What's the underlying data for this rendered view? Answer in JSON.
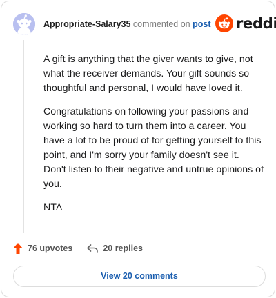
{
  "comment": {
    "username": "Appropriate-Salary35",
    "action_text": "commented on",
    "post_link": "post",
    "paragraphs": [
      "A gift is anything that the giver wants to give, not what the receiver demands. Your gift sounds so thoughtful and personal, I would have loved it.",
      "Congratulations on following your passions and working so hard to turn them into a career. You have a lot to be proud of for getting yourself to this point, and I'm sorry your family doesn't see it. Don't listen to their negative and untrue opinions of you.",
      "NTA"
    ]
  },
  "brand": {
    "name": "reddit",
    "color": "#ff4500"
  },
  "stats": {
    "upvotes_label": "76 upvotes",
    "replies_label": "20 replies"
  },
  "footer": {
    "view_comments_label": "View 20 comments"
  },
  "icons": {
    "avatar": "snoo-avatar-icon",
    "logo": "reddit-logo-icon",
    "upvote": "upvote-arrow-icon",
    "reply": "reply-arrow-icon"
  },
  "colors": {
    "accent": "#ff4500",
    "link": "#1c5fb0",
    "avatar_bg": "#b9c0f0"
  }
}
